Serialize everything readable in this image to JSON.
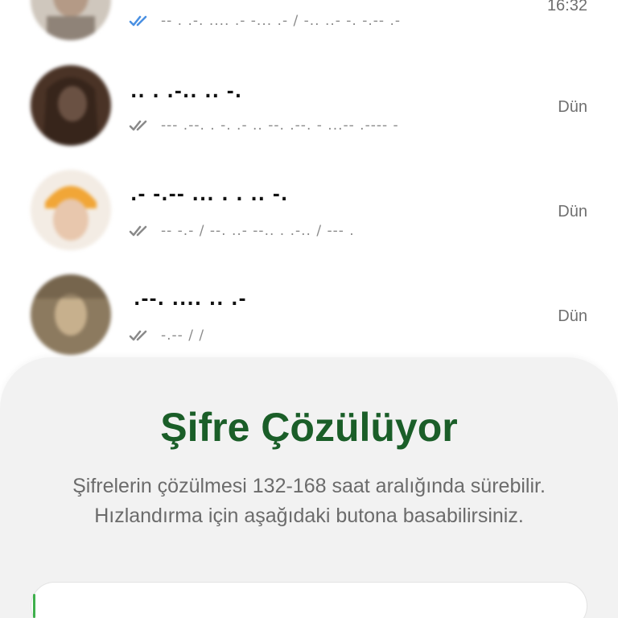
{
  "chats": [
    {
      "name": "",
      "preview": "-- . .-. .... .- -... .- / -.. ..- -. -.-- .-",
      "time": "16:32",
      "tick_color": "#4a90e2",
      "avatar": "avatar-person-1"
    },
    {
      "name": ".. . .-.. .. -.",
      "preview": "--- .--. . -. .- .. --. .--. - ...-- .---- -",
      "time": "Dün",
      "tick_color": "#8a8a8a",
      "avatar": "avatar-person-2"
    },
    {
      "name": ".- -.-- ... . . .. -.",
      "preview": "-- -.- / --. ..- --.. . .-.. / --- .",
      "time": "Dün",
      "tick_color": "#8a8a8a",
      "avatar": "avatar-person-3"
    },
    {
      "name": ".--. .... .. .-",
      "preview": "-.-- / /",
      "time": "Dün",
      "tick_color": "#8a8a8a",
      "avatar": "avatar-person-4"
    }
  ],
  "sheet": {
    "title": "Şifre Çözülüyor",
    "description": "Şifrelerin çözülmesi 132-168 saat aralığında sürebilir. Hızlandırma için aşağıdaki butona basabilirsiniz.",
    "button_label": "",
    "title_color": "#1a5e28",
    "accent_color": "#3fb04c"
  }
}
